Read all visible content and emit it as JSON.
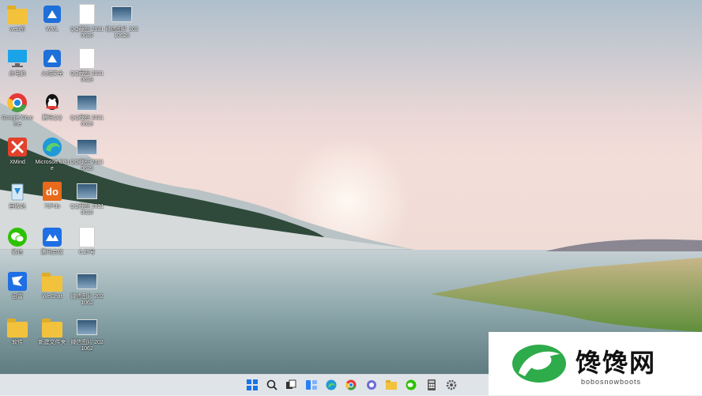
{
  "desktop": {
    "icons": [
      {
        "label": "web所",
        "type": "folder"
      },
      {
        "label": "WML",
        "type": "app-blue"
      },
      {
        "label": "QQ截图 20210629",
        "type": "doc"
      },
      {
        "label": "微信图片 20210629",
        "type": "thumb"
      },
      {
        "label": "此电脑",
        "type": "monitor"
      },
      {
        "label": "火绒安全",
        "type": "app-blue"
      },
      {
        "label": "QQ截图 20210629",
        "type": "doc"
      },
      {
        "label": "Google Chrome",
        "type": "chrome"
      },
      {
        "label": "腾讯QQ",
        "type": "qq"
      },
      {
        "label": "QQ截图 20210629",
        "type": "thumb"
      },
      {
        "label": "XMind",
        "type": "xmind"
      },
      {
        "label": "Microsoft Edge",
        "type": "edge"
      },
      {
        "label": "QQ截图 20210629",
        "type": "thumb"
      },
      {
        "label": "回收站",
        "type": "recycle"
      },
      {
        "label": "79Pdo",
        "type": "do"
      },
      {
        "label": "QQ截图 20210629",
        "type": "thumb"
      },
      {
        "label": "微信",
        "type": "wechat"
      },
      {
        "label": "腾讯会议",
        "type": "meeting"
      },
      {
        "label": "6.29号",
        "type": "doc"
      },
      {
        "label": "迅雷",
        "type": "xunlei"
      },
      {
        "label": "WeChat",
        "type": "folder"
      },
      {
        "label": "微信图片 2021062",
        "type": "thumb"
      },
      {
        "label": "软件",
        "type": "folder"
      },
      {
        "label": "新建文件夹",
        "type": "folder"
      },
      {
        "label": "微信图片 2021062",
        "type": "thumb"
      }
    ]
  },
  "taskbar": {
    "icons": [
      "windows-start-icon",
      "search-icon",
      "task-view-icon",
      "widgets-icon",
      "edge-icon",
      "chrome-icon",
      "chat-icon",
      "file-explorer-icon",
      "wechat-icon",
      "calculator-icon",
      "settings-icon"
    ]
  },
  "watermark": {
    "text": "馋馋网",
    "sub": "bobosnowboots"
  },
  "colors": {
    "accent": "#2a7ff7",
    "watermark_green": "#2eab4a"
  }
}
